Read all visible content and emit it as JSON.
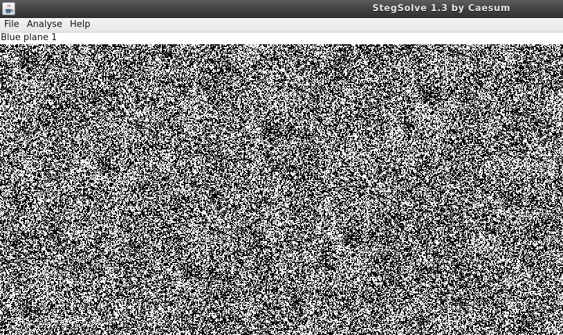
{
  "window": {
    "title": "StegSolve 1.3 by Caesum",
    "icon": "java-cup-icon"
  },
  "menu": {
    "items": [
      {
        "label": "File"
      },
      {
        "label": "Analyse"
      },
      {
        "label": "Help"
      }
    ]
  },
  "viewer": {
    "plane_label": "Blue plane 1",
    "image": "noise-bitplane-black-white"
  },
  "colors": {
    "titlebar": "#3f4143",
    "title_text": "#e6e6e6",
    "menubar": "#eeeeee",
    "pixel_on": "#ffffff",
    "pixel_off": "#000000"
  }
}
